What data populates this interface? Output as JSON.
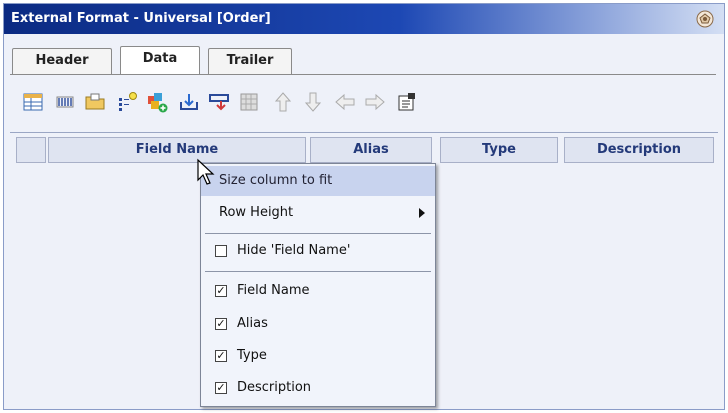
{
  "window": {
    "title": "External Format - Universal [Order]",
    "title_icon": "window-settings-icon"
  },
  "tabs": [
    {
      "label": "Header",
      "active": false
    },
    {
      "label": "Data",
      "active": true
    },
    {
      "label": "Trailer",
      "active": false
    }
  ],
  "toolbar": {
    "icons": [
      "insert-row-icon",
      "columns-icon",
      "open-folder-icon",
      "add-field-icon",
      "add-component-icon",
      "import-icon",
      "export-icon",
      "grid-icon",
      "move-up-icon",
      "move-down-icon",
      "move-left-icon",
      "move-right-icon",
      "properties-icon"
    ]
  },
  "grid": {
    "columns": [
      "Field Name",
      "Alias",
      "Type",
      "Description"
    ]
  },
  "context_menu": {
    "items": [
      {
        "label": "Size column to fit",
        "highlighted": true
      },
      {
        "label": "Row Height",
        "submenu": true
      },
      {
        "label": "Hide 'Field Name'",
        "checked": false
      },
      {
        "label": "Field Name",
        "checked": true
      },
      {
        "label": "Alias",
        "checked": true
      },
      {
        "label": "Type",
        "checked": true
      },
      {
        "label": "Description",
        "checked": true
      }
    ]
  },
  "colors": {
    "title_gradient_start": "#0b2a82",
    "panel_bg": "#eef1f9",
    "menu_highlight": "#c8d3ee",
    "header_text": "#243a7a"
  }
}
